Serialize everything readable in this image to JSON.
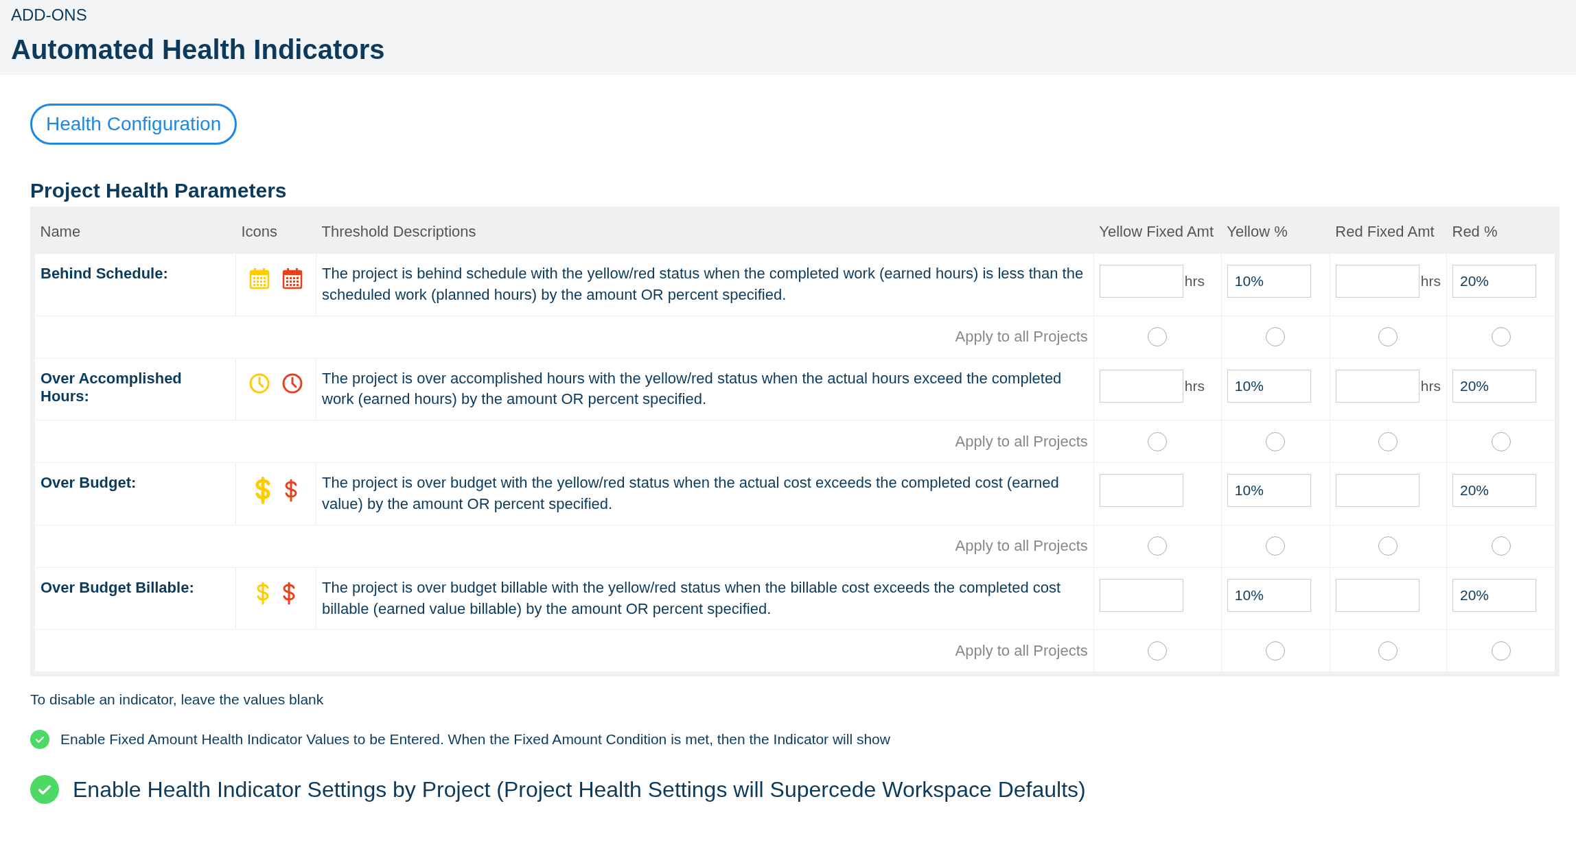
{
  "header": {
    "breadcrumb": "ADD-ONS",
    "title": "Automated Health Indicators"
  },
  "config_button": "Health Configuration",
  "section_title": "Project Health Parameters",
  "table": {
    "columns": [
      "Name",
      "Icons",
      "Threshold Descriptions",
      "Yellow Fixed Amt",
      "Yellow %",
      "Red Fixed Amt",
      "Red %"
    ],
    "rows": [
      {
        "name": "Behind Schedule:",
        "icons": [
          {
            "kind": "calendar",
            "color": "#ffcc00"
          },
          {
            "kind": "calendar",
            "color": "#e8401c"
          }
        ],
        "description": "The project is behind schedule with the yellow/red status when the completed work (earned hours) is less than the scheduled work (planned hours) by the amount OR percent specified.",
        "yellow_fixed": {
          "unit": "hrs"
        },
        "yellow_pct": {
          "value": "10%"
        },
        "red_fixed": {
          "unit": "hrs"
        },
        "red_pct": {
          "value": "20%"
        },
        "apply_label": "Apply to all Projects",
        "apply": [
          {
            "selected": false
          },
          {
            "selected": false
          },
          {
            "selected": false
          },
          {
            "selected": false
          }
        ]
      },
      {
        "name": "Over Accomplished Hours:",
        "icons": [
          {
            "kind": "clock",
            "color": "#ffcc00"
          },
          {
            "kind": "clock",
            "color": "#e8401c"
          }
        ],
        "description": "The project is over accomplished hours with the yellow/red status when the actual hours exceed the completed work (earned hours) by the amount OR percent specified.",
        "yellow_fixed": {
          "unit": "hrs"
        },
        "yellow_pct": {
          "value": "10%"
        },
        "red_fixed": {
          "unit": "hrs"
        },
        "red_pct": {
          "value": "20%"
        },
        "apply_label": "Apply to all Projects",
        "apply": [
          {
            "selected": false
          },
          {
            "selected": false
          },
          {
            "selected": false
          },
          {
            "selected": false
          }
        ]
      },
      {
        "name": "Over Budget:",
        "icons": [
          {
            "kind": "dollar-bold",
            "color": "#ffcc00"
          },
          {
            "kind": "dollar",
            "color": "#e8401c"
          }
        ],
        "description": "The project is over budget with the yellow/red status when the actual cost exceeds the completed cost (earned value) by the amount OR percent specified.",
        "yellow_fixed": {},
        "yellow_pct": {
          "value": "10%"
        },
        "red_fixed": {},
        "red_pct": {
          "value": "20%"
        },
        "apply_label": "Apply to all Projects",
        "apply": [
          {
            "selected": false
          },
          {
            "selected": false
          },
          {
            "selected": false
          },
          {
            "selected": false
          }
        ]
      },
      {
        "name": "Over Budget Billable:",
        "icons": [
          {
            "kind": "dollar",
            "color": "#ffcc00"
          },
          {
            "kind": "dollar",
            "color": "#e8401c"
          }
        ],
        "description": "The project is over budget billable with the yellow/red status when the billable cost exceeds the completed cost billable (earned value billable) by the amount OR percent specified.",
        "yellow_fixed": {},
        "yellow_pct": {
          "value": "10%"
        },
        "red_fixed": {},
        "red_pct": {
          "value": "20%"
        },
        "apply_label": "Apply to all Projects",
        "apply": [
          {
            "selected": false
          },
          {
            "selected": false
          },
          {
            "selected": false
          },
          {
            "selected": false
          }
        ]
      }
    ]
  },
  "note": "To disable an indicator, leave the values blank",
  "options": [
    {
      "kind": "small",
      "checked": true,
      "label": "Enable Fixed Amount Health Indicator Values to be Entered. When the Fixed Amount Condition is met, then the Indicator will show"
    },
    {
      "kind": "large",
      "checked": true,
      "label": "Enable Health Indicator Settings by Project (Project Health Settings will Supercede Workspace Defaults)"
    }
  ]
}
